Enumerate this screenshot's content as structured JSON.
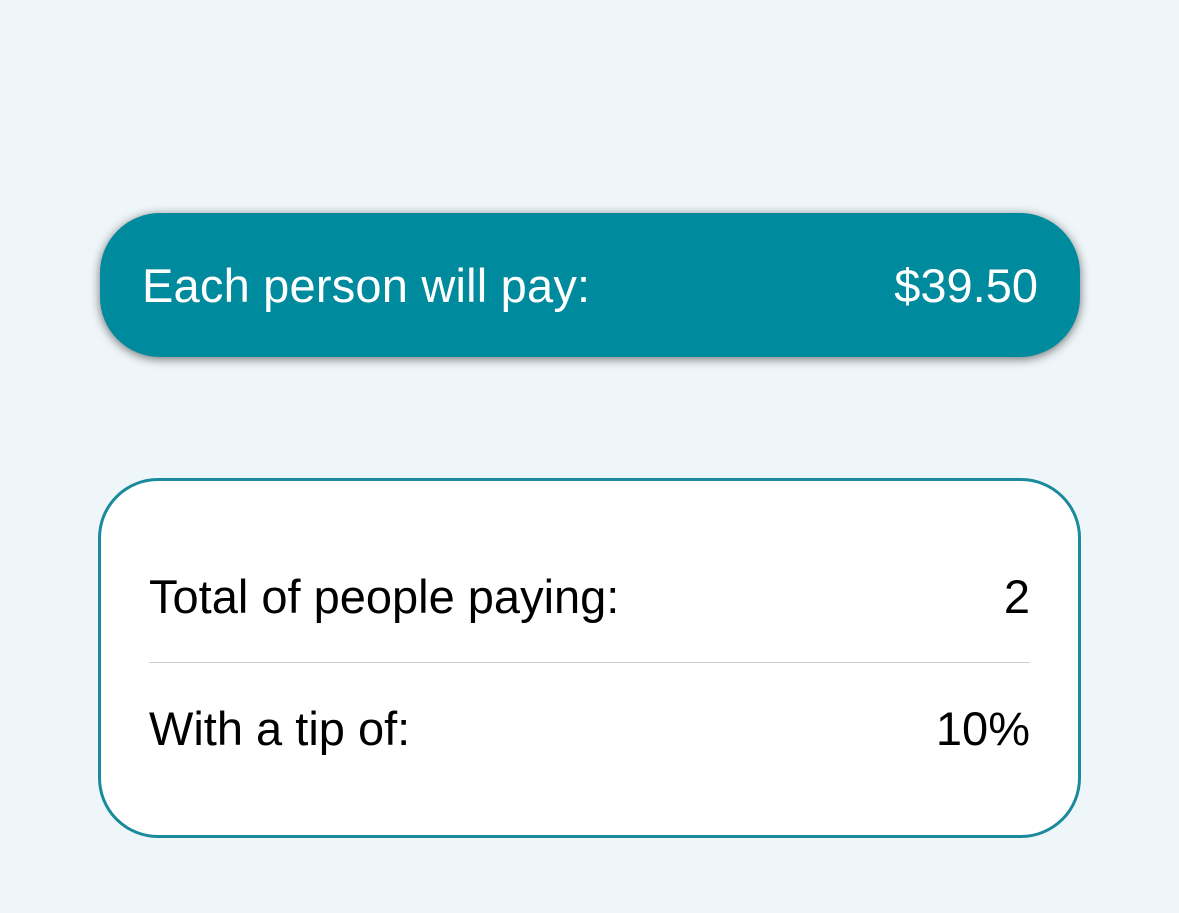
{
  "colors": {
    "background": "#EFF6F9",
    "accent": "#008A9D",
    "card_border": "#1A8A9C"
  },
  "summary": {
    "label": "Each person will pay:",
    "amount": "$39.50"
  },
  "details": {
    "people_label": "Total of people paying:",
    "people_value": "2",
    "tip_label": "With a tip of:",
    "tip_value": "10%"
  }
}
